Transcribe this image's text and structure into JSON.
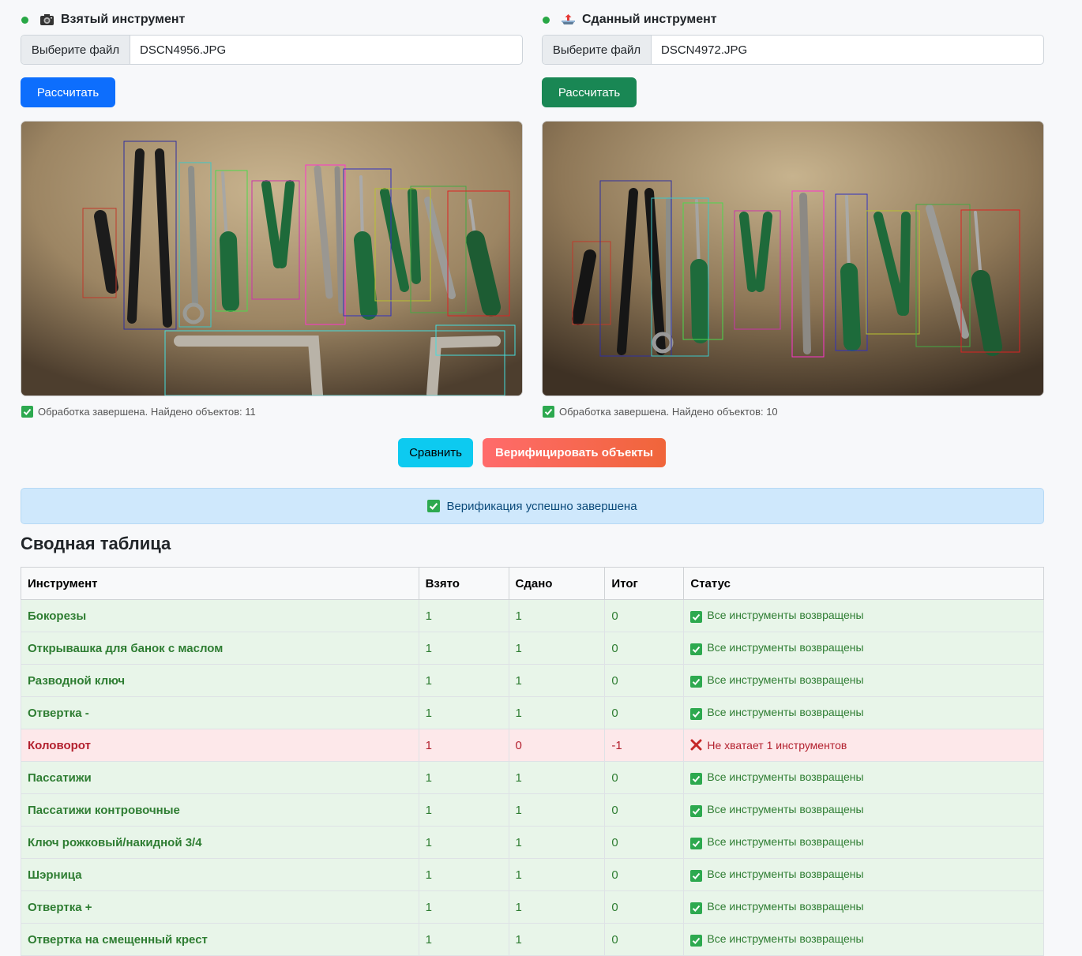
{
  "taken": {
    "title": "Взятый инструмент",
    "icon": "camera-icon",
    "file_button": "Выберите файл",
    "file_name": "DSCN4956.JPG",
    "calc_label": "Рассчитать",
    "status": "Обработка завершена. Найдено объектов: 11"
  },
  "returned": {
    "title": "Сданный инструмент",
    "icon": "outbox-tray-icon",
    "file_button": "Выберите файл",
    "file_name": "DSCN4972.JPG",
    "calc_label": "Рассчитать",
    "status": "Обработка завершена. Найдено объектов: 10"
  },
  "actions": {
    "compare_label": "Сравнить",
    "verify_label": "Верифицировать объекты"
  },
  "alert": {
    "text": "Верификация успешно завершена"
  },
  "summary": {
    "title": "Сводная таблица",
    "headers": [
      "Инструмент",
      "Взято",
      "Сдано",
      "Итог",
      "Статус"
    ],
    "rows": [
      {
        "name": "Бокорезы",
        "taken": "1",
        "returned": "1",
        "total": "0",
        "status": "Все инструменты возвращены",
        "ok": true
      },
      {
        "name": "Открывашка для банок с маслом",
        "taken": "1",
        "returned": "1",
        "total": "0",
        "status": "Все инструменты возвращены",
        "ok": true
      },
      {
        "name": "Разводной ключ",
        "taken": "1",
        "returned": "1",
        "total": "0",
        "status": "Все инструменты возвращены",
        "ok": true
      },
      {
        "name": "Отвертка -",
        "taken": "1",
        "returned": "1",
        "total": "0",
        "status": "Все инструменты возвращены",
        "ok": true
      },
      {
        "name": "Коловорот",
        "taken": "1",
        "returned": "0",
        "total": "-1",
        "status": "Не хватает 1 инструментов",
        "ok": false
      },
      {
        "name": "Пассатижи",
        "taken": "1",
        "returned": "1",
        "total": "0",
        "status": "Все инструменты возвращены",
        "ok": true
      },
      {
        "name": "Пассатижи контровочные",
        "taken": "1",
        "returned": "1",
        "total": "0",
        "status": "Все инструменты возвращены",
        "ok": true
      },
      {
        "name": "Ключ рожковый/накидной 3/4",
        "taken": "1",
        "returned": "1",
        "total": "0",
        "status": "Все инструменты возвращены",
        "ok": true
      },
      {
        "name": "Шэрница",
        "taken": "1",
        "returned": "1",
        "total": "0",
        "status": "Все инструменты возвращены",
        "ok": true
      },
      {
        "name": "Отвертка +",
        "taken": "1",
        "returned": "1",
        "total": "0",
        "status": "Все инструменты возвращены",
        "ok": true
      },
      {
        "name": "Отвертка на смещенный крест",
        "taken": "1",
        "returned": "1",
        "total": "0",
        "status": "Все инструменты возвращены",
        "ok": true
      }
    ]
  },
  "colors": {
    "primary": "#0d6efd",
    "success": "#198754",
    "info": "#0dcaf0",
    "ok_row": "#e8f5e9",
    "bad_row": "#fde8ea"
  }
}
